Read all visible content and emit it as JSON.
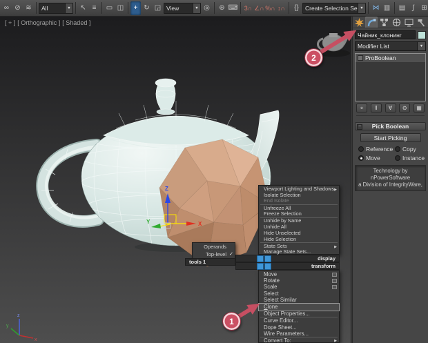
{
  "glyphs": {
    "dropdown_arrow": "▼",
    "submenu_arrow": "▶",
    "checkmark": "✓",
    "minus": "−"
  },
  "toolbar": {
    "selection_filter_value": "All",
    "ref_coord_value": "View",
    "selection_set_value": "Create Selection Se",
    "icons": [
      {
        "name": "select-and-link",
        "glyph": "∞"
      },
      {
        "name": "unlink-selection",
        "glyph": "⊘"
      },
      {
        "name": "bind-to-space-warp",
        "glyph": "≋"
      },
      {
        "name": "select-object",
        "glyph": "↖"
      },
      {
        "name": "select-by-name",
        "glyph": "≡"
      },
      {
        "name": "rectangular-selection-region",
        "glyph": "▭"
      },
      {
        "name": "window-crossing",
        "glyph": "◫"
      },
      {
        "name": "select-and-move",
        "glyph": "+"
      },
      {
        "name": "select-and-rotate",
        "glyph": "↻"
      },
      {
        "name": "select-and-scale",
        "glyph": "◲"
      },
      {
        "name": "use-pivot-point-center",
        "glyph": "◎"
      },
      {
        "name": "select-and-manipulate",
        "glyph": "⊕"
      },
      {
        "name": "keyboard-shortcut-override",
        "glyph": "⌨"
      },
      {
        "name": "snap-toggle-3d",
        "glyph": "3∩"
      },
      {
        "name": "angle-snap",
        "glyph": "∠∩"
      },
      {
        "name": "percent-snap",
        "glyph": "%∩"
      },
      {
        "name": "spinner-snap",
        "glyph": "↕∩"
      },
      {
        "name": "edit-named-selection-sets",
        "glyph": "{}"
      },
      {
        "name": "mirror",
        "glyph": "⋈"
      },
      {
        "name": "align",
        "glyph": "▥"
      },
      {
        "name": "layer-manager",
        "glyph": "▤"
      },
      {
        "name": "curve-editor",
        "glyph": "∫"
      },
      {
        "name": "schematic-view",
        "glyph": "⊞"
      },
      {
        "name": "material-editor",
        "glyph": "◉"
      }
    ]
  },
  "viewport": {
    "label_plus": "[ + ]",
    "label_pov": "[ Orthographic ]",
    "label_shading": "[ Shaded ]",
    "gizmo": {
      "x": "X",
      "y": "Y",
      "z": "Z"
    },
    "world_axis": {
      "x": "x",
      "y": "y",
      "z": "z"
    }
  },
  "quad_menu": {
    "titles": {
      "left": "tools 1",
      "upper_right": "display",
      "lower_right": "transform"
    },
    "left_items": [
      {
        "label": "Operands"
      },
      {
        "label": "Top-level",
        "checked": true
      }
    ],
    "display_items": [
      {
        "label": "Viewport Lighting and Shadows",
        "submenu": true
      },
      {
        "label": "Isolate Selection"
      },
      {
        "label": "End Isolate",
        "disabled": true
      },
      {
        "label": "Unfreeze All"
      },
      {
        "label": "Freeze Selection"
      },
      {
        "label": "Unhide by Name"
      },
      {
        "label": "Unhide All"
      },
      {
        "label": "Hide Unselected"
      },
      {
        "label": "Hide Selection"
      },
      {
        "label": "State Sets",
        "submenu": true
      },
      {
        "label": "Manage State Sets..."
      }
    ],
    "transform_items": [
      {
        "label": "Move",
        "settings": true
      },
      {
        "label": "Rotate",
        "settings": true
      },
      {
        "label": "Scale",
        "settings": true
      },
      {
        "label": "Select"
      },
      {
        "label": "Select Similar"
      },
      {
        "label": "Clone",
        "highlighted": true
      },
      {
        "label": "Object Properties..."
      },
      {
        "label": "Curve Editor..."
      },
      {
        "label": "Dope Sheet..."
      },
      {
        "label": "Wire Parameters..."
      },
      {
        "label": "Convert To:",
        "submenu": true
      }
    ]
  },
  "command_panel": {
    "tabs": [
      "create",
      "modify",
      "hierarchy",
      "motion",
      "display",
      "utilities"
    ],
    "active_tab": "modify",
    "object_name": "Чайник_клонинг",
    "object_color": "#bfe3da",
    "modifier_list_label": "Modifier List",
    "modifier_stack": [
      {
        "label": "ProBoolean"
      }
    ],
    "stack_buttons": [
      {
        "name": "pin-stack",
        "glyph": "⌖"
      },
      {
        "name": "show-end-result",
        "glyph": "‖"
      },
      {
        "name": "make-unique",
        "glyph": "∀"
      },
      {
        "name": "remove-modifier",
        "glyph": "⊖"
      },
      {
        "name": "configure-modifier-sets",
        "glyph": "▦"
      }
    ],
    "rollout": {
      "title": "Pick Boolean",
      "start_picking_label": "Start Picking",
      "radio_options": [
        "Reference",
        "Copy",
        "Move",
        "Instance"
      ],
      "selected_option": "Move",
      "tech_text_line1": "Technology by nPowerSoftware",
      "tech_text_line2": "a Division of IntegrityWare,"
    }
  },
  "callouts": [
    {
      "number": "1"
    },
    {
      "number": "2"
    }
  ],
  "colors": {
    "accent_blue": "#3f97d9",
    "callout": "#cb4f63",
    "teapot": "#d6e6e3",
    "polyhedron": "#cf9f7f"
  }
}
